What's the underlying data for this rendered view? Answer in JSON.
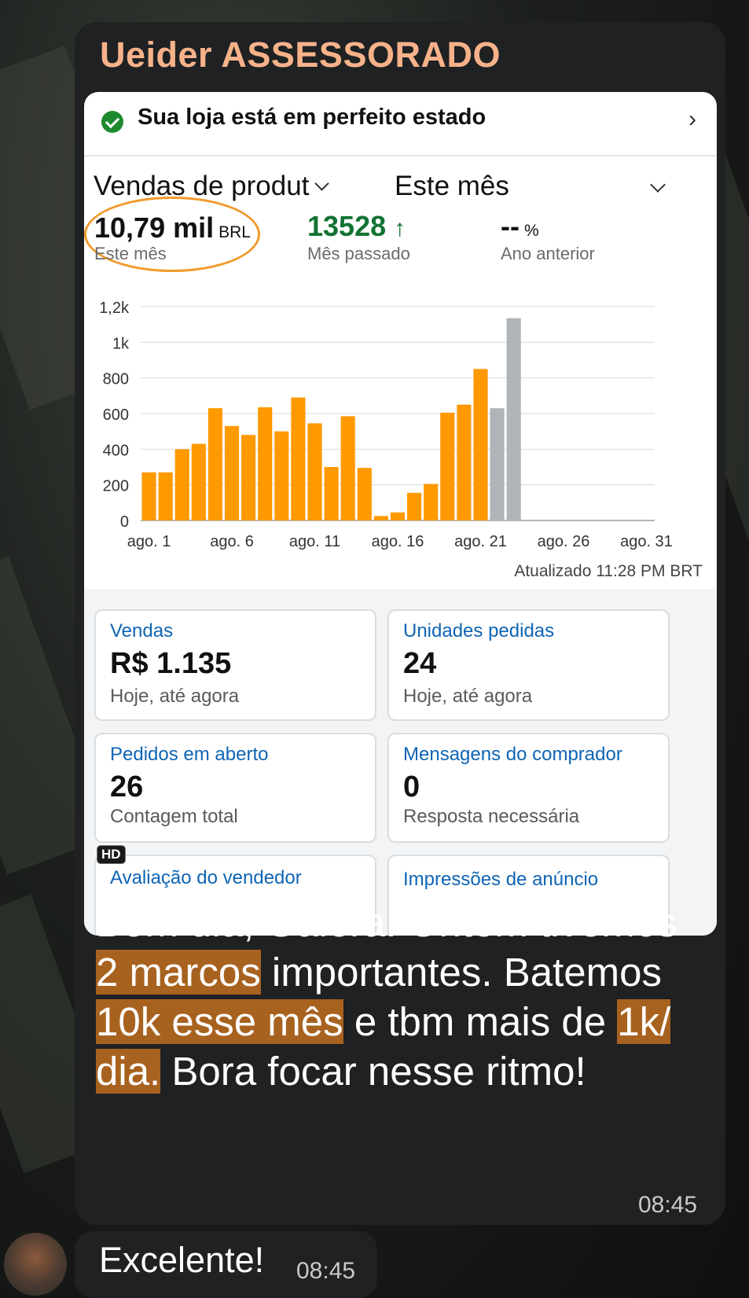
{
  "chat": {
    "sender_name": "Ueider ASSESSORADO",
    "message": {
      "parts": [
        {
          "text": "Bom dia, Galera! Ontem tivemos ",
          "highlight": false
        },
        {
          "text": "2 marcos",
          "highlight": true
        },
        {
          "text": " importantes. Batemos ",
          "highlight": false
        },
        {
          "text": "10k esse mês",
          "highlight": true
        },
        {
          "text": " e tbm mais de ",
          "highlight": false
        },
        {
          "text": "1k/ dia.",
          "highlight": true
        },
        {
          "text": " Bora focar nesse ritmo!",
          "highlight": false
        }
      ],
      "time": "08:45",
      "badge": "HD"
    },
    "reply": {
      "text": "Excelente!",
      "time": "08:45"
    }
  },
  "dashboard": {
    "health_status": "Sua loja está em perfeito estado",
    "metric_selector": "Vendas de produt",
    "period_selector": "Este mês",
    "this_month": {
      "value": "10,79 mil",
      "unit": "BRL",
      "label": "Este mês"
    },
    "last_month": {
      "value": "13528",
      "arrow": "↑",
      "label": "Mês passado"
    },
    "last_year": {
      "value": "--",
      "unit": "%",
      "label": "Ano anterior"
    },
    "updated": "Atualizado 11:28 PM BRT",
    "cards": [
      {
        "title": "Vendas",
        "value": "R$ 1.135",
        "sub": "Hoje, até agora"
      },
      {
        "title": "Unidades pedidas",
        "value": "24",
        "sub": "Hoje, até agora"
      },
      {
        "title": "Pedidos em aberto",
        "value": "26",
        "sub": "Contagem total"
      },
      {
        "title": "Mensagens do comprador",
        "value": "0",
        "sub": "Resposta necessária"
      },
      {
        "title": "Avaliação do vendedor",
        "value": "",
        "sub": ""
      },
      {
        "title": "Impressões de anúncio",
        "value": "",
        "sub": ""
      }
    ],
    "colors": {
      "accent": "#ff9900",
      "comparison": "#b0b3b8",
      "link": "#0f65b4",
      "positive": "#137333"
    }
  },
  "chart_data": {
    "type": "bar",
    "x_tick_labels": [
      "ago. 1",
      "ago. 6",
      "ago. 11",
      "ago. 16",
      "ago. 21",
      "ago. 26",
      "ago. 31"
    ],
    "y_tick_labels": [
      "0",
      "200",
      "400",
      "600",
      "800",
      "1k",
      "1,2k"
    ],
    "ylim": [
      0,
      1200
    ],
    "grid": true,
    "x_range": [
      1,
      31
    ],
    "series": [
      {
        "x": [
          1,
          2,
          3,
          4,
          5,
          6,
          7,
          8,
          9,
          10,
          11,
          12,
          13,
          14,
          15,
          16,
          17,
          18,
          19,
          20,
          21
        ],
        "values": [
          270,
          270,
          400,
          430,
          630,
          530,
          480,
          635,
          500,
          690,
          545,
          300,
          585,
          295,
          25,
          45,
          155,
          205,
          605,
          650,
          850
        ],
        "color": "#ff9900"
      },
      {
        "x": [
          22,
          23
        ],
        "values": [
          630,
          1135
        ],
        "color": "#b0b3b8"
      }
    ]
  }
}
